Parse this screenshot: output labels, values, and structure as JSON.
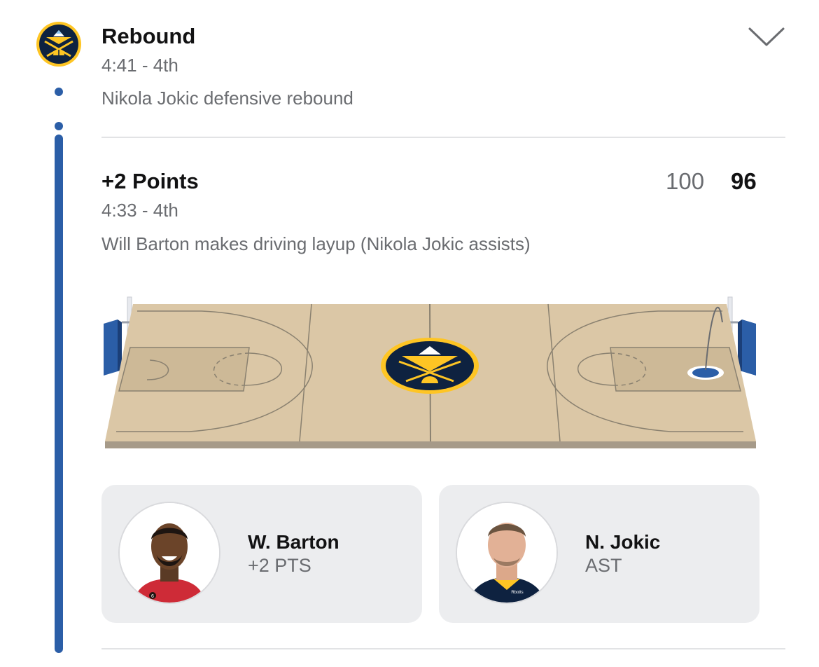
{
  "events": [
    {
      "title": "Rebound",
      "time": "4:41 - 4th",
      "description": "Nikola Jokic defensive rebound"
    },
    {
      "title": "+2 Points",
      "time": "4:33 - 4th",
      "description": "Will Barton makes driving layup (Nikola Jokic assists)",
      "score_away": "100",
      "score_home": "96",
      "players": [
        {
          "name": "W. Barton",
          "stat": "+2 PTS",
          "jersey": "6"
        },
        {
          "name": "N. Jokic",
          "stat": "AST",
          "jersey_text": "Rbotts"
        }
      ]
    }
  ],
  "icons": {
    "team_logo": "nuggets-logo-icon",
    "expand": "chevron-down-icon"
  },
  "colors": {
    "timeline": "#2b5ea7",
    "court_floor": "#dbc7a6",
    "navy": "#0e2240",
    "gold": "#fec524"
  }
}
